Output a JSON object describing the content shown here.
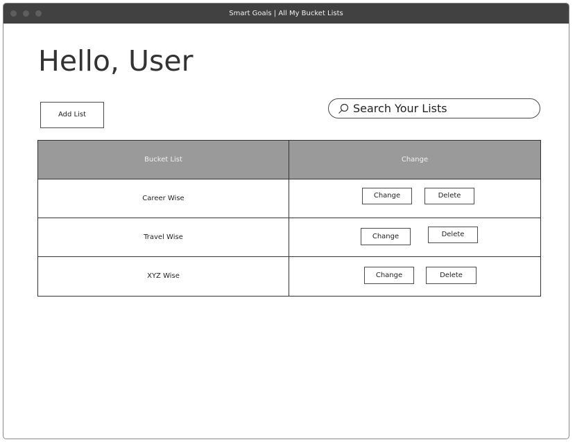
{
  "window": {
    "title": "Smart Goals | All My Bucket Lists"
  },
  "page": {
    "greeting": "Hello, User",
    "add_list_label": "Add List",
    "search_placeholder": "Search Your Lists"
  },
  "table": {
    "headers": [
      "Bucket List",
      "Change"
    ],
    "rows": [
      {
        "name": "Career Wise",
        "change_label": "Change",
        "delete_label": "Delete"
      },
      {
        "name": "Travel Wise",
        "change_label": "Change",
        "delete_label": "Delete"
      },
      {
        "name": "XYZ Wise",
        "change_label": "Change",
        "delete_label": "Delete"
      }
    ]
  },
  "icons": {
    "search": "search-icon"
  }
}
